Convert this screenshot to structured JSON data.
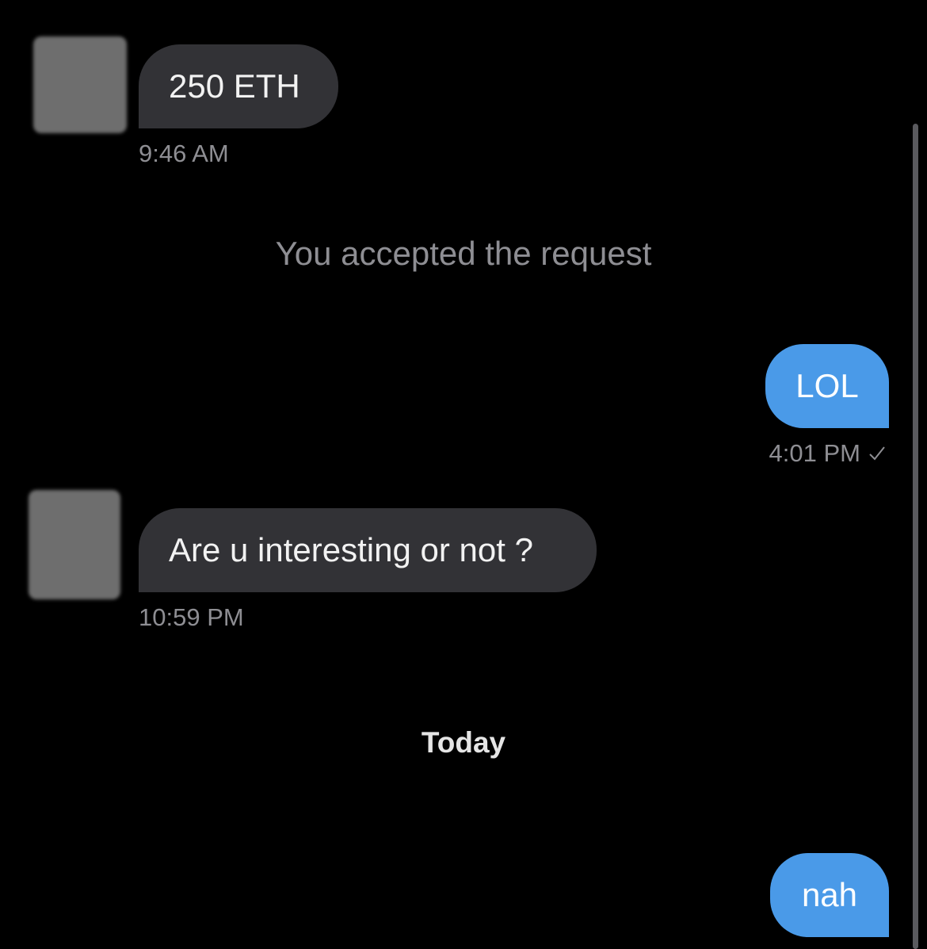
{
  "messages": [
    {
      "direction": "incoming",
      "text": "250 ETH",
      "time": "9:46 AM"
    },
    {
      "direction": "outgoing",
      "text": "LOL",
      "time": "4:01 PM",
      "status_icon": "check-icon"
    },
    {
      "direction": "incoming",
      "text": "Are u interesting or not ?",
      "time": "10:59 PM"
    },
    {
      "direction": "outgoing",
      "text": "nah"
    }
  ],
  "system_message": "You accepted the request",
  "day_divider": "Today",
  "colors": {
    "background": "#000000",
    "incoming_bubble": "#323236",
    "outgoing_bubble": "#4a9ae8",
    "timestamp": "#8e8e93"
  }
}
